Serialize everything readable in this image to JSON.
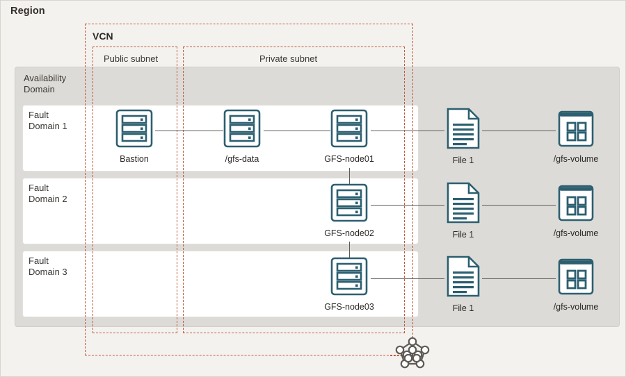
{
  "diagram": {
    "title": "Region",
    "accent_dashed_color": "#c0563a",
    "icon_color": "#2c5f70",
    "availability_domain_bg": "#dddbd7",
    "canvas_bg": "#f4f2ef"
  },
  "region": {
    "label": "Region"
  },
  "vcn": {
    "label": "VCN",
    "subnets": [
      {
        "id": "public",
        "label": "Public subnet"
      },
      {
        "id": "private",
        "label": "Private subnet"
      }
    ]
  },
  "availability_domain": {
    "label": "Availability\nDomain",
    "fault_domains": [
      {
        "id": "fd1",
        "label": "Fault\nDomain 1"
      },
      {
        "id": "fd2",
        "label": "Fault\nDomain 2"
      },
      {
        "id": "fd3",
        "label": "Fault\nDomain 3"
      }
    ]
  },
  "nodes": {
    "bastion": {
      "label": "Bastion",
      "icon": "server-icon"
    },
    "gfs_data": {
      "label": "/gfs-data",
      "icon": "server-icon"
    },
    "gfs_node01": {
      "label": "GFS-node01",
      "icon": "server-icon"
    },
    "gfs_node02": {
      "label": "GFS-node02",
      "icon": "server-icon"
    },
    "gfs_node03": {
      "label": "GFS-node03",
      "icon": "server-icon"
    },
    "file1_fd1": {
      "label": "File 1",
      "icon": "file-icon"
    },
    "file1_fd2": {
      "label": "File 1",
      "icon": "file-icon"
    },
    "file1_fd3": {
      "label": "File 1",
      "icon": "file-icon"
    },
    "volume_fd1": {
      "label": "/gfs-volume",
      "icon": "block-volume-icon"
    },
    "volume_fd2": {
      "label": "/gfs-volume",
      "icon": "block-volume-icon"
    },
    "volume_fd3": {
      "label": "/gfs-volume",
      "icon": "block-volume-icon"
    },
    "network": {
      "label": "",
      "icon": "network-mesh-icon"
    }
  }
}
